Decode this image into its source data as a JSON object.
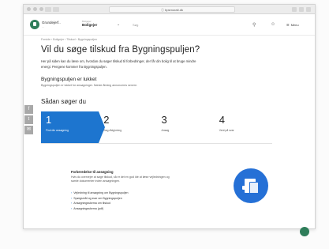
{
  "browser": {
    "url": "ⓘ bpsmorait.dk"
  },
  "header": {
    "logo_name": "Grundejerf..",
    "logo_sub": "...",
    "nav_label": "Boligejer",
    "nav_selected": "Boligejer",
    "nav_sub": "...",
    "nav_chevron": "⌄",
    "search_label": "Søg",
    "menu_label": "Menu",
    "icon_names": [
      "lock-icon",
      "user-icon",
      "menu-icon"
    ]
  },
  "breadcrumb": "Forside › Boligejer › Tilskud › Bygningspuljen",
  "main": {
    "title": "Vil du søge tilskud fra Bygningspuljen?",
    "intro": "Her på siden kan du læse om, hvordan du søger tilskud til forbedringer, der får din bolig til at bruge mindre energi. Pengene kommer fra Bygningspuljen.",
    "closed_heading": "Bygningspuljen er lukket",
    "closed_text": "Bygningspuljen er lukket for ansøgninger. Næste åbning annonceres senere.",
    "how_heading": "Sådan søger du",
    "steps": [
      {
        "num": "1",
        "label": "Find din ansøgning",
        "active": true
      },
      {
        "num": "2",
        "label": "Søg rådgivning",
        "active": false
      },
      {
        "num": "3",
        "label": "Ansøg",
        "active": false
      },
      {
        "num": "4",
        "label": "Vent på svar",
        "active": false
      }
    ],
    "lower_heading": "Forberedelse til ansøgning",
    "lower_text": "Hvis du overvejer at søge tilskud, så er det en god idé at læse vejledningen og samle dokumenter inden ansøgningen.",
    "documents": [
      "Vejledning til ansøgning om Bygningspuljen",
      "Spørgsmål og svar om Bygningspuljen",
      "Ansøgningsskema om tilskud",
      "Ansøgningsskema (pdf)"
    ]
  },
  "share": {
    "icons": [
      "facebook-icon",
      "twitter-icon",
      "email-icon"
    ]
  },
  "colors": {
    "accent": "#1d75cf",
    "brand": "#2f7d5a"
  }
}
